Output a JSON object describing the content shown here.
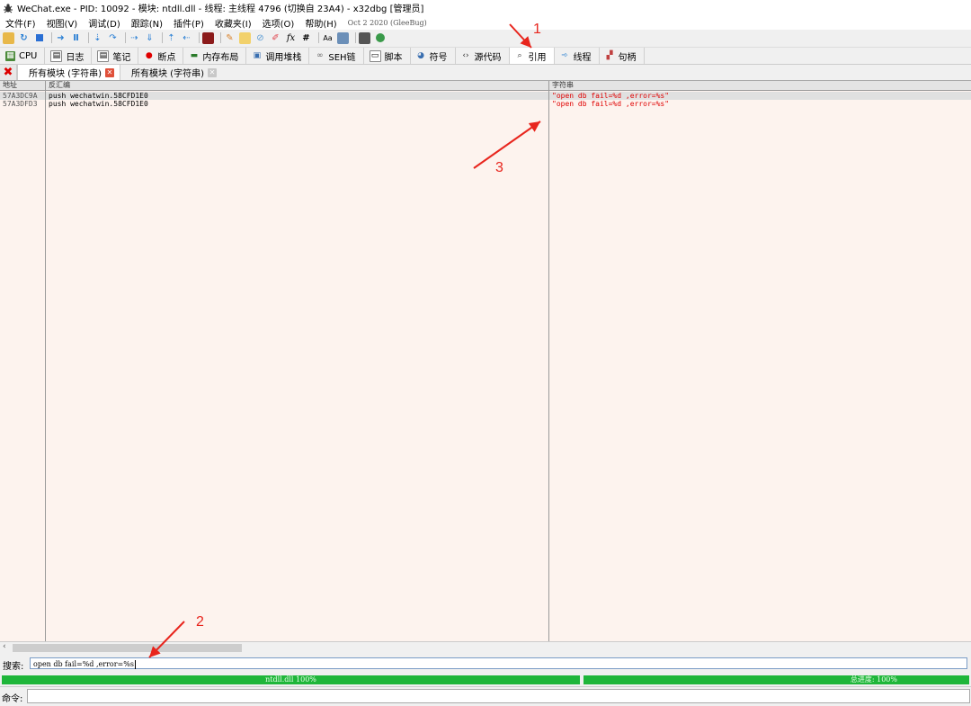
{
  "window": {
    "title": "WeChat.exe - PID: 10092 - 模块: ntdll.dll - 线程: 主线程 4796 (切换自 23A4) - x32dbg [管理员]"
  },
  "menu": {
    "items": [
      "文件(F)",
      "视图(V)",
      "调试(D)",
      "跟踪(N)",
      "插件(P)",
      "收藏夹(I)",
      "选项(O)",
      "帮助(H)"
    ],
    "version": "Oct 2 2020 (GleeBug)"
  },
  "tabs": [
    {
      "label": "CPU",
      "icon": "cpu-icon"
    },
    {
      "label": "日志",
      "icon": "log-icon"
    },
    {
      "label": "笔记",
      "icon": "notes-icon"
    },
    {
      "label": "断点",
      "icon": "breakpoint-icon"
    },
    {
      "label": "内存布局",
      "icon": "memory-map-icon"
    },
    {
      "label": "调用堆栈",
      "icon": "call-stack-icon"
    },
    {
      "label": "SEH链",
      "icon": "seh-chain-icon"
    },
    {
      "label": "脚本",
      "icon": "script-icon"
    },
    {
      "label": "符号",
      "icon": "symbols-icon"
    },
    {
      "label": "源代码",
      "icon": "source-icon"
    },
    {
      "label": "引用",
      "icon": "references-icon",
      "active": true
    },
    {
      "label": "线程",
      "icon": "threads-icon"
    },
    {
      "label": "句柄",
      "icon": "handles-icon"
    }
  ],
  "subtabs": [
    {
      "label": "所有模块 (字符串)",
      "active": true
    },
    {
      "label": "所有模块 (字符串)",
      "active": false
    }
  ],
  "table": {
    "columns": [
      "地址",
      "反汇编",
      "字符串"
    ],
    "rows": [
      {
        "address": "57A3DC9A",
        "disasm": "push wechatwin.58CFD1E0",
        "string": "\"open db fail=%d ,error=%s\"",
        "selected": true
      },
      {
        "address": "57A3DFD3",
        "disasm": "push wechatwin.58CFD1E0",
        "string": "\"open db fail=%d ,error=%s\"",
        "selected": false
      }
    ]
  },
  "search": {
    "label": "搜索:",
    "value": "open db fail=%d ,error=%s"
  },
  "progress": {
    "left_text": "ntdll.dll 100%",
    "left_value": 1.0,
    "right_text": "总进度: 100%",
    "right_value": 1.0
  },
  "command": {
    "label": "命令:",
    "value": ""
  },
  "annotations": [
    "1",
    "2",
    "3"
  ],
  "colors": {
    "accent_red": "#e8251d",
    "progress_green": "#1fb63a",
    "string_red": "#e00000"
  }
}
